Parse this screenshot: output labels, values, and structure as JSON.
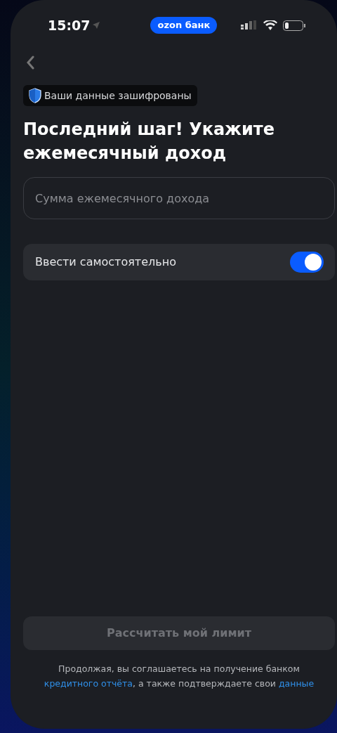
{
  "status_bar": {
    "time": "15:07",
    "app_badge": "ozon банк"
  },
  "security_badge": {
    "label": "Ваши данные зашифрованы"
  },
  "title": "Последний шаг! Укажите ежемесячный доход",
  "income_field": {
    "placeholder": "Сумма ежемесячного дохода"
  },
  "manual_entry": {
    "label": "Ввести самостоятельно",
    "on": true
  },
  "submit_button": {
    "label": "Рассчитать мой лимит",
    "disabled": true
  },
  "legal_text": [
    {
      "kind": "text",
      "text": "Продолжая, вы соглашаетесь на получение банком "
    },
    {
      "kind": "link",
      "text": "кредитного отчёта"
    },
    {
      "kind": "text",
      "text": ", а также подтверждаете свои "
    },
    {
      "kind": "link",
      "text": "данные"
    }
  ]
}
